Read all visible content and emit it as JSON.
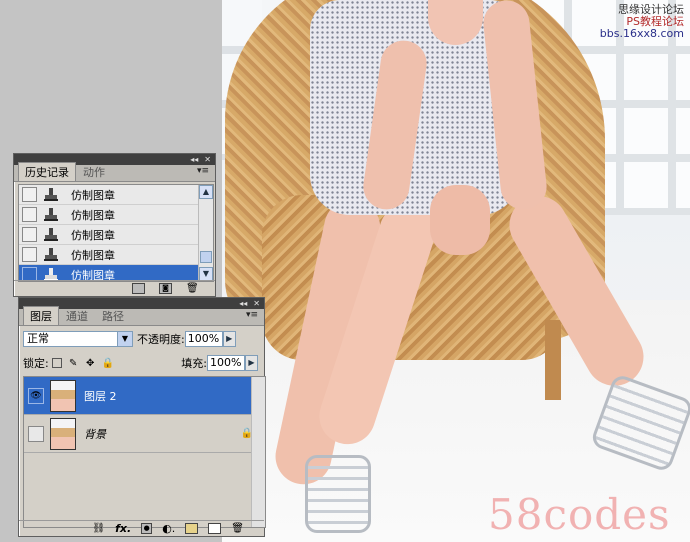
{
  "watermarks": {
    "top_line1": "思缘设计论坛",
    "top_line2": "PS教程论坛",
    "top_line3": "bbs.16xx8.com",
    "bottom": "58codes"
  },
  "history_panel": {
    "tabs": [
      "历史记录",
      "动作"
    ],
    "items": [
      {
        "label": "仿制图章",
        "selected": false
      },
      {
        "label": "仿制图章",
        "selected": false
      },
      {
        "label": "仿制图章",
        "selected": false
      },
      {
        "label": "仿制图章",
        "selected": false
      },
      {
        "label": "仿制图章",
        "selected": true
      }
    ],
    "footer_icons": [
      "new-document-from-state-icon",
      "new-snapshot-icon",
      "delete-state-icon"
    ]
  },
  "layers_panel": {
    "tabs": [
      "图层",
      "通道",
      "路径"
    ],
    "blend_mode": "正常",
    "opacity_label": "不透明度:",
    "opacity_value": "100%",
    "lock_label": "锁定:",
    "fill_label": "填充:",
    "fill_value": "100%",
    "layers": [
      {
        "name": "图层 2",
        "selected": true,
        "visible": true,
        "locked": false
      },
      {
        "name": "背景",
        "selected": false,
        "visible": false,
        "locked": true
      }
    ],
    "footer_icons": [
      "link-layers-icon",
      "fx-icon",
      "mask-icon",
      "adjustment-layer-icon",
      "group-icon",
      "new-layer-icon",
      "delete-layer-icon"
    ]
  },
  "colors": {
    "selection": "#316ac5",
    "panel_bg": "#d4d0c8"
  }
}
